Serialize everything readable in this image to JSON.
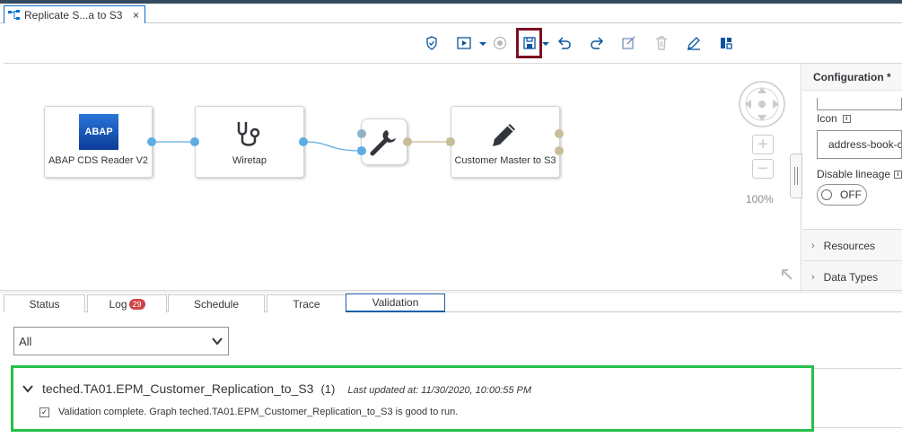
{
  "tab": {
    "title": "Replicate S...a to S3",
    "close": "×"
  },
  "toolbar": {
    "buttons": [
      "validate-icon",
      "run-icon",
      "stop-icon",
      "save-icon",
      "undo-icon",
      "redo-icon",
      "edit-form-icon",
      "delete-icon",
      "pencil-icon",
      "layout-icon"
    ]
  },
  "graph": {
    "operators": [
      {
        "id": "abap",
        "label": "ABAP CDS Reader V2",
        "icon_text": "ABAP"
      },
      {
        "id": "wiretap",
        "label": "Wiretap"
      },
      {
        "id": "converter",
        "label": ""
      },
      {
        "id": "customer",
        "label": "Customer Master to S3"
      }
    ],
    "zoom": "100%"
  },
  "config": {
    "header": "Configuration *",
    "icon_label": "Icon",
    "icon_value": "address-book-c",
    "lineage_label": "Disable lineage",
    "lineage_state": "OFF",
    "info": "i",
    "sections": [
      "Resources",
      "Data Types"
    ]
  },
  "bottom": {
    "tabs": [
      "Status",
      "Log",
      "Schedule",
      "Trace",
      "Validation"
    ],
    "log_count": "29",
    "filter": "All"
  },
  "result": {
    "title": "teched.TA01.EPM_Customer_Replication_to_S3",
    "count": "(1)",
    "updated": "Last updated at: 11/30/2020, 10:00:55 PM",
    "message": "Validation complete. Graph teched.TA01.EPM_Customer_Replication_to_S3 is good to run.",
    "check": "✓"
  },
  "colors": {
    "accent": "#0a6ed1",
    "highlight": "#7b1020",
    "success": "#25c04a",
    "badge": "#d04343"
  }
}
